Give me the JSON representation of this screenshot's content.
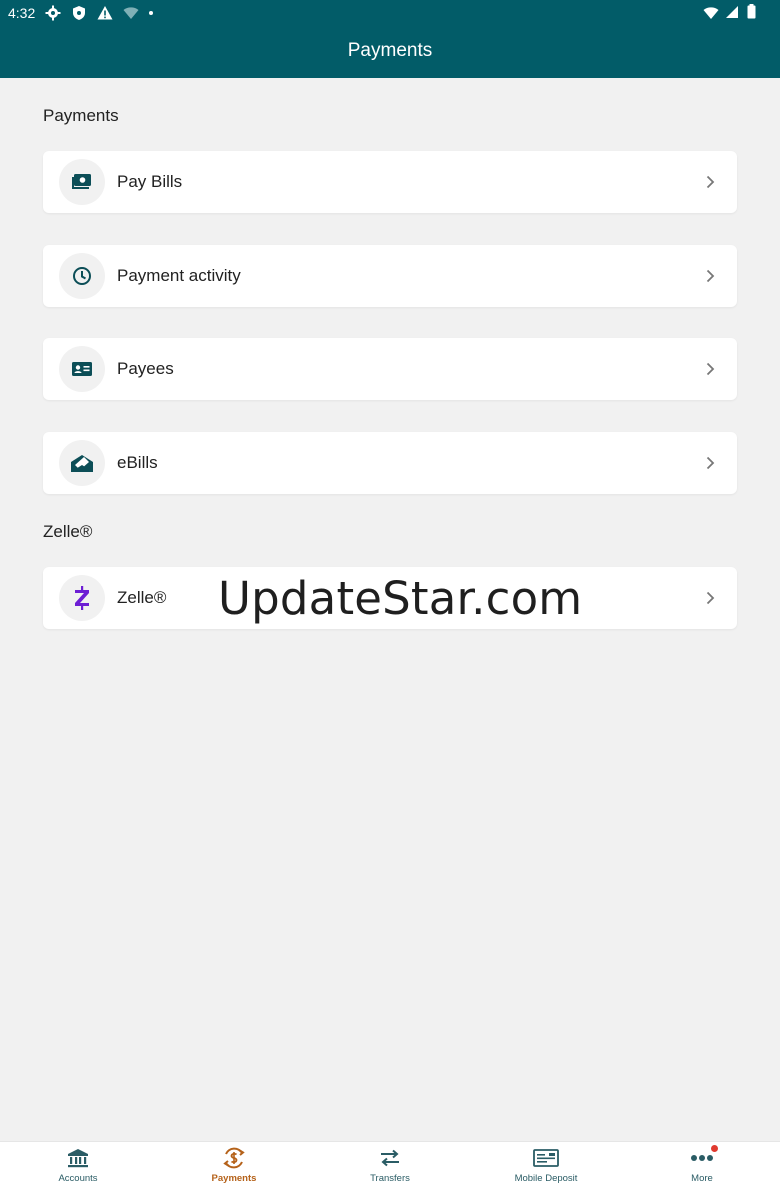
{
  "status_bar": {
    "time": "4:32"
  },
  "app_bar": {
    "title": "Payments"
  },
  "sections": [
    {
      "title": "Payments",
      "items": [
        {
          "label": "Pay Bills",
          "icon": "bill-pay-icon"
        },
        {
          "label": "Payment activity",
          "icon": "clock-icon"
        },
        {
          "label": "Payees",
          "icon": "id-card-icon"
        },
        {
          "label": "eBills",
          "icon": "envelope-bill-icon"
        }
      ]
    },
    {
      "title": "Zelle®",
      "items": [
        {
          "label": "Zelle®",
          "icon": "zelle-logo-icon"
        }
      ]
    }
  ],
  "watermark": "UpdateStar.com",
  "bottom_nav": {
    "items": [
      {
        "label": "Accounts",
        "icon": "bank-icon",
        "active": false
      },
      {
        "label": "Payments",
        "icon": "payments-icon",
        "active": true
      },
      {
        "label": "Transfers",
        "icon": "transfer-arrows-icon",
        "active": false
      },
      {
        "label": "Mobile Deposit",
        "icon": "check-deposit-icon",
        "active": false
      },
      {
        "label": "More",
        "icon": "more-dots-icon",
        "active": false
      }
    ]
  },
  "colors": {
    "brand": "#025c68",
    "active_nav": "#b5621a",
    "background": "#f1f1f1",
    "zelle": "#6d1ed4",
    "notification": "#e03a2f"
  }
}
